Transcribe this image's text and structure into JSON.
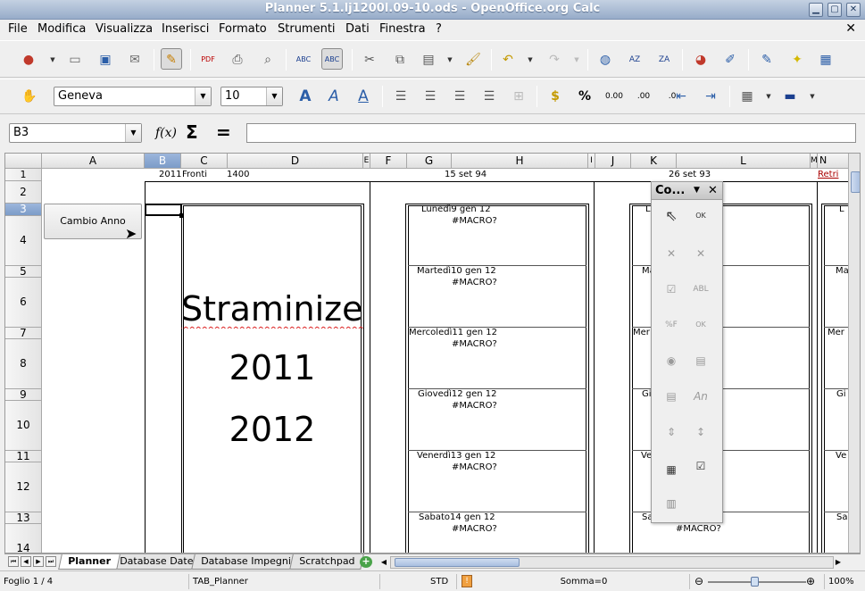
{
  "window": {
    "title": "Planner 5.1.lj1200l.09-10.ods - OpenOffice.org Calc",
    "min": "▁",
    "max": "▢",
    "close": "✕"
  },
  "menu": [
    "File",
    "Modifica",
    "Visualizza",
    "Inserisci",
    "Formato",
    "Strumenti",
    "Dati",
    "Finestra",
    "?"
  ],
  "menu_close": "✕",
  "format": {
    "font": "Geneva",
    "size": "10"
  },
  "formula": {
    "namebox": "B3",
    "fx": "f(x)",
    "sum": "Σ",
    "eq": "=",
    "value": ""
  },
  "columns": [
    "A",
    "B",
    "C",
    "D",
    "E",
    "F",
    "G",
    "H",
    "I",
    "J",
    "K",
    "L",
    "M",
    "N"
  ],
  "rows": [
    "1",
    "2",
    "3",
    "4",
    "5",
    "6",
    "7",
    "8",
    "9",
    "10",
    "11",
    "12",
    "13",
    "14"
  ],
  "cells": {
    "b1": "2011",
    "c1": "Fronti",
    "d1": "1400",
    "h1": "15 set 94",
    "l1": "26 set 93",
    "n1": "Retri",
    "button": "Cambio Anno",
    "big_title": "Straminizer",
    "big_y1": "2011",
    "big_y2": "2012",
    "days": [
      "Lunedì9 gen 12",
      "Martedì10 gen 12",
      "Mercoledì11 gen 12",
      "Giovedì12 gen 12",
      "Venerdì13 gen 12",
      "Sabato14 gen 12"
    ],
    "macro": "#MACRO?",
    "k_days": [
      "L",
      "Ma",
      "Mer",
      "Gi",
      "Ve",
      "Sa"
    ],
    "n_days": [
      "L",
      "Ma",
      "Mer",
      "Gi",
      "Ve",
      "Sa"
    ]
  },
  "floatbar": {
    "title": "Co...",
    "close": "✕",
    "text_an": "An",
    "ok": "OK",
    "abl": "ABL",
    "pf": "%F"
  },
  "tabs": [
    "Planner",
    "Database Date",
    "Database Impegni",
    "Scratchpad"
  ],
  "status": {
    "sheet": "Foglio 1 / 4",
    "page": "TAB_Planner",
    "mode": "STD",
    "sum": "Somma=0",
    "zoom": "100%"
  }
}
